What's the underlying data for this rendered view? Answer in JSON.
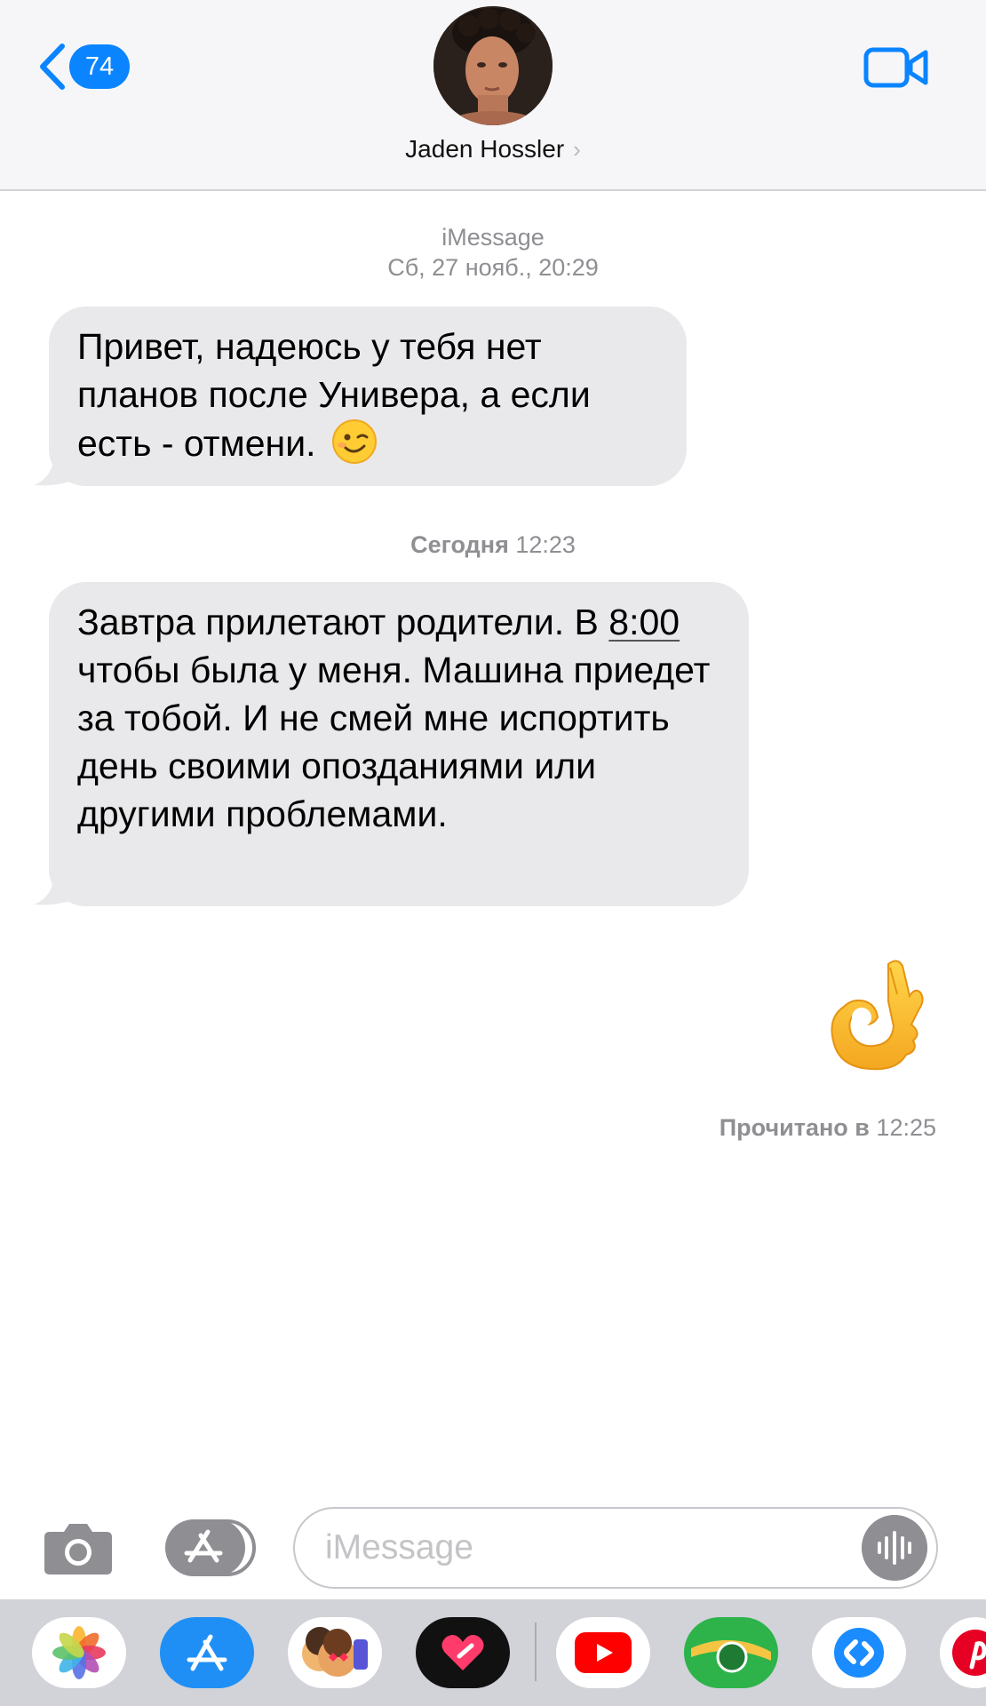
{
  "header": {
    "back_badge": "74",
    "contact_name": "Jaden Hossler",
    "chevron": "›",
    "video_icon": "video-camera-icon"
  },
  "conversation": {
    "meta1_service": "iMessage",
    "meta1_date": "Сб, 27 нояб., 20:29",
    "message1": {
      "text": "Привет, надеюсь у тебя нет планов после Универа, а если есть - отмени.",
      "emoji": "winking-face"
    },
    "meta2_day": "Сегодня",
    "meta2_time": "12:23",
    "message2": {
      "part1": "Завтра прилетают родители. В",
      "time_link": "8:00",
      "part2": "чтобы была у меня. Машина приедет за тобой. И не смей мне испортить день своими опозданиями или другими проблемами."
    },
    "sent_emoji": "ok-hand",
    "read_label": "Прочитано в",
    "read_time": "12:25"
  },
  "input": {
    "placeholder": "iMessage"
  },
  "apps": [
    "Photos",
    "App Store",
    "Memoji",
    "Heart app",
    "YouTube",
    "Maps",
    "Shazam",
    "Pinterest"
  ],
  "colors": {
    "accent": "#0a84ff",
    "bubble_gray": "#e9e9eb",
    "meta_text": "#8e8e93"
  }
}
